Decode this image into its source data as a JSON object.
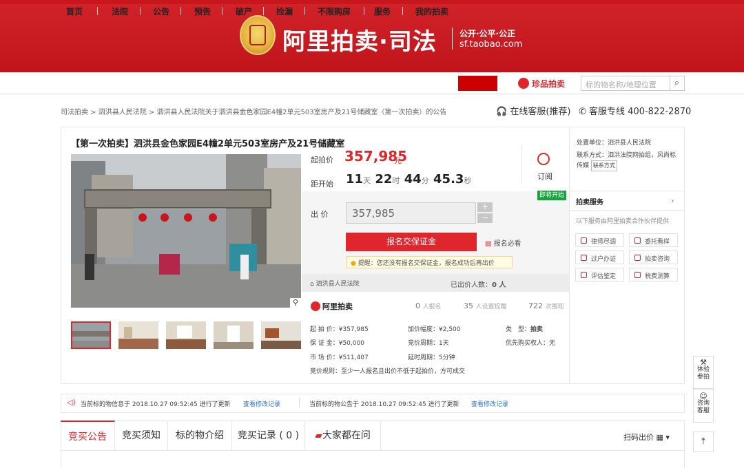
{
  "banner": {
    "logo_text": "阿里拍卖·司法",
    "slogan": "公开·公平·公正",
    "domain": "sf.taobao.com"
  },
  "nav": {
    "items": [
      "首页",
      "法院",
      "公告",
      "预告",
      "破产",
      "捡漏",
      "不限购房",
      "服务",
      "我的拍卖"
    ],
    "zhenpin": "珍品拍卖",
    "search_placeholder": "标的物名称/地理位置"
  },
  "breadcrumb": "司法拍卖 > 泗洪县人民法院 > 泗洪县人民法院关于泗洪县金色家园E4幢2单元503室房产及21号储藏室（第一次拍卖）的公告",
  "service": {
    "online": "在线客服(推荐)",
    "hotline": "客服专线 400-822-2870"
  },
  "item": {
    "title": "【第一次拍卖】泗洪县金色家园E4幢2单元503室房产及21号储藏室",
    "start_label": "起拍价",
    "start_price": "357,985",
    "yuan": "元",
    "countdown_label": "距开始",
    "cd_days": "11",
    "cd_days_unit": "天",
    "cd_hours": "22",
    "cd_hours_unit": "时",
    "cd_min": "44",
    "cd_min_unit": "分",
    "cd_sec": "45.3",
    "cd_sec_unit": "秒",
    "remind": "订阅",
    "soon": "即将开始",
    "bid_label": "出 价",
    "bid_value": "357,985",
    "plus": "+",
    "minus": "−",
    "signup": "报名交保证金",
    "must_read": "报名必看",
    "tip": "提醒：您还没有报名交保证金，报名成功后再出价",
    "court": "泗洪县人民法院",
    "bidders_label": "已出价人数：",
    "bidders_count": "0 人",
    "ali_brand": "阿里拍卖",
    "stat_signup_num": "0",
    "stat_signup": "人报名",
    "stat_remind_num": "35",
    "stat_remind": "人设置提醒",
    "stat_view_num": "722",
    "stat_view": "次围观",
    "info": {
      "start": "起 拍 价：¥357,985",
      "deposit": "保 证 金：¥50,000",
      "market": "市 场 价：¥511,407",
      "increment": "加价幅度：¥2,500",
      "cycle": "竞价周期：1天",
      "delay": "延时周期：5分钟",
      "type_label": "类　型：",
      "type_value": "拍卖",
      "priority": "优先购买权人",
      "priority_value": "：无",
      "rule": "竞价规则：至少一人报名且出价不低于起拍价，方可成交"
    }
  },
  "right": {
    "unit": "处置单位：泗洪县人民法院",
    "contact": "联系方式：泗洪法院网拍组，风尚标传媒",
    "contact_btn": "联系方式",
    "svc_head": "拍卖服务",
    "svc_arrow": "›",
    "svc_sub": "以下服务由阿里拍卖合作伙伴提供",
    "svc_buttons": [
      "律师尽调",
      "委托看样",
      "过户办证",
      "拍卖咨询",
      "评估鉴定",
      "税费测算"
    ]
  },
  "notice": {
    "left": "当前标的物信息于 2018.10.27 09:52:45 进行了更新",
    "left_link": "查看修改记录",
    "right": "当前标的物公告于 2018.10.27 09:52:45 进行了更新",
    "right_link": "查看修改记录"
  },
  "tabs": {
    "t1": "竞买公告",
    "t2": "竞买须知",
    "t3": "标的物介绍",
    "t4": "竞买记录 ( 0 )",
    "t5": "大家都在问",
    "scan": "扫码出价"
  },
  "side": {
    "exp": "体验参拍",
    "consult": "咨询客服"
  },
  "colors": {
    "brand_red": "#c8161d",
    "price_red": "#e0262d",
    "soon_green": "#15a33b",
    "link_blue": "#2a6fd6"
  }
}
